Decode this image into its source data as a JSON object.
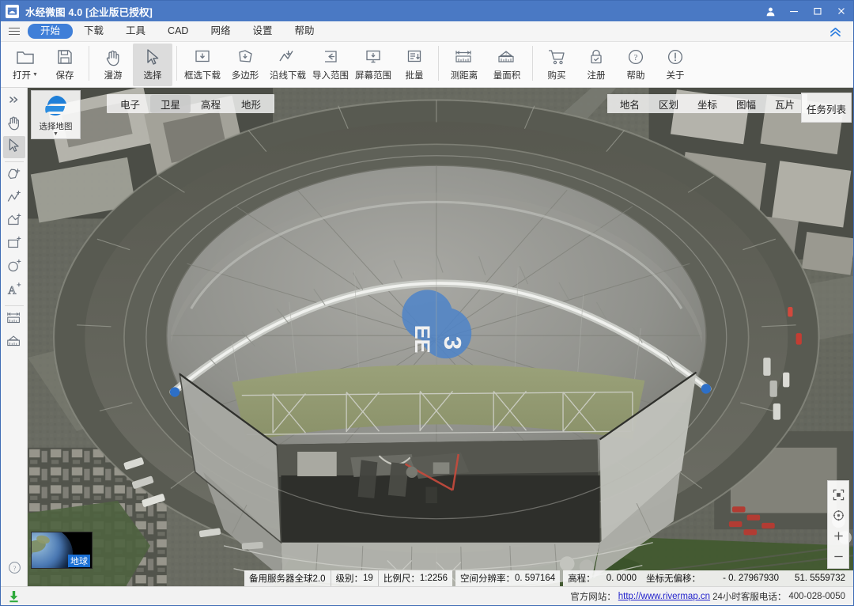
{
  "window": {
    "title": "水经微图 4.0 [企业版已授权]",
    "logo_icon": "app-logo-icon",
    "account_icon": "user-account-icon",
    "minimize_icon": "minimize-icon",
    "maximize_icon": "maximize-icon",
    "close_icon": "close-icon",
    "accent_color": "#4a79c4"
  },
  "menubar": {
    "hamburger_icon": "hamburger-menu-icon",
    "collapse_icon": "chevron-double-up-icon",
    "items": [
      {
        "label": "开始",
        "active": true
      },
      {
        "label": "下载",
        "active": false
      },
      {
        "label": "工具",
        "active": false
      },
      {
        "label": "CAD",
        "active": false
      },
      {
        "label": "网络",
        "active": false
      },
      {
        "label": "设置",
        "active": false
      },
      {
        "label": "帮助",
        "active": false
      }
    ]
  },
  "ribbon": {
    "groups": [
      {
        "buttons": [
          {
            "label": "打开",
            "icon": "folder-open-icon",
            "dropdown": true,
            "selected": false
          },
          {
            "label": "保存",
            "icon": "save-disk-icon",
            "dropdown": false,
            "selected": false
          }
        ]
      },
      {
        "buttons": [
          {
            "label": "漫游",
            "icon": "pan-hand-icon",
            "dropdown": false,
            "selected": false
          },
          {
            "label": "选择",
            "icon": "cursor-arrow-icon",
            "dropdown": false,
            "selected": true
          }
        ]
      },
      {
        "buttons": [
          {
            "label": "框选下载",
            "icon": "rect-download-icon",
            "dropdown": false,
            "selected": false
          },
          {
            "label": "多边形",
            "icon": "polygon-download-icon",
            "dropdown": false,
            "selected": false
          },
          {
            "label": "沿线下载",
            "icon": "polyline-download-icon",
            "dropdown": false,
            "selected": false
          },
          {
            "label": "导入范围",
            "icon": "import-range-icon",
            "dropdown": false,
            "selected": false
          },
          {
            "label": "屏幕范围",
            "icon": "screen-range-icon",
            "dropdown": false,
            "selected": false
          },
          {
            "label": "批量",
            "icon": "batch-list-icon",
            "dropdown": false,
            "selected": false
          }
        ]
      },
      {
        "buttons": [
          {
            "label": "测距离",
            "icon": "measure-distance-icon",
            "dropdown": false,
            "selected": false
          },
          {
            "label": "量面积",
            "icon": "measure-area-icon",
            "dropdown": false,
            "selected": false
          }
        ]
      },
      {
        "buttons": [
          {
            "label": "购买",
            "icon": "shopping-cart-icon",
            "dropdown": false,
            "selected": false
          },
          {
            "label": "注册",
            "icon": "lock-register-icon",
            "dropdown": false,
            "selected": false
          },
          {
            "label": "帮助",
            "icon": "question-circle-icon",
            "dropdown": false,
            "selected": false
          },
          {
            "label": "关于",
            "icon": "info-circle-icon",
            "dropdown": false,
            "selected": false
          }
        ]
      }
    ]
  },
  "sidebar": {
    "items": [
      {
        "name": "collapse-arrows",
        "icon": "double-right-arrow-icon",
        "selected": false
      },
      {
        "name": "pan",
        "icon": "pan-hand-icon",
        "selected": false
      },
      {
        "name": "select",
        "icon": "cursor-arrow-icon",
        "selected": true
      },
      {
        "name": "add-polygon-freeform",
        "icon": "freeform-plus-icon",
        "selected": false
      },
      {
        "name": "add-polyline",
        "icon": "polyline-plus-icon",
        "selected": false
      },
      {
        "name": "add-polygon",
        "icon": "polygon-plus-icon",
        "selected": false
      },
      {
        "name": "add-rectangle",
        "icon": "rectangle-plus-icon",
        "selected": false
      },
      {
        "name": "add-circle",
        "icon": "circle-plus-icon",
        "selected": false
      },
      {
        "name": "add-text",
        "icon": "text-plus-icon",
        "selected": false
      },
      {
        "name": "measure-distance",
        "icon": "measure-distance-icon",
        "selected": false
      },
      {
        "name": "measure-area",
        "icon": "measure-area-icon",
        "selected": false
      }
    ],
    "help": {
      "name": "help",
      "icon": "question-circle-icon"
    }
  },
  "map": {
    "select_map": {
      "label": "选择地图",
      "icon": "globe-logo-icon",
      "caret": "▼"
    },
    "layer_tabs": [
      {
        "label": "电子",
        "active": false
      },
      {
        "label": "卫星",
        "active": true
      },
      {
        "label": "高程",
        "active": false
      },
      {
        "label": "地形",
        "active": false
      }
    ],
    "right_tabs": [
      {
        "label": "地名"
      },
      {
        "label": "区划"
      },
      {
        "label": "坐标"
      },
      {
        "label": "图幅"
      },
      {
        "label": "瓦片"
      }
    ],
    "task_list_label": "任务列表",
    "globe_thumb": {
      "label": "地球",
      "icon": "earth-globe-icon"
    },
    "nav_controls": [
      {
        "name": "fit-extent",
        "icon": "fit-extent-icon"
      },
      {
        "name": "compass",
        "icon": "compass-icon"
      },
      {
        "name": "zoom-in",
        "icon": "plus-icon"
      },
      {
        "name": "zoom-out",
        "icon": "minus-icon"
      }
    ]
  },
  "statusbar": {
    "server": "备用服务器全球2.0",
    "level_label": "级别：",
    "level_value": "19",
    "scale_label": "比例尺：",
    "scale_value": "1:2256",
    "resolution_label": "空间分辨率：",
    "resolution_value": "0. 597164",
    "elevation_label": "高程：",
    "elevation_value": "0. 0000",
    "offset_label": "坐标无偏移：",
    "longitude": "- 0. 27967930",
    "latitude": "51. 5559732"
  },
  "footer": {
    "download_icon": "download-arrow-icon",
    "site_label": "官方网站：",
    "site_url": "http://www.rivermap.cn",
    "support_label": "24小时客服电话：",
    "support_phone": "400-028-0050"
  }
}
